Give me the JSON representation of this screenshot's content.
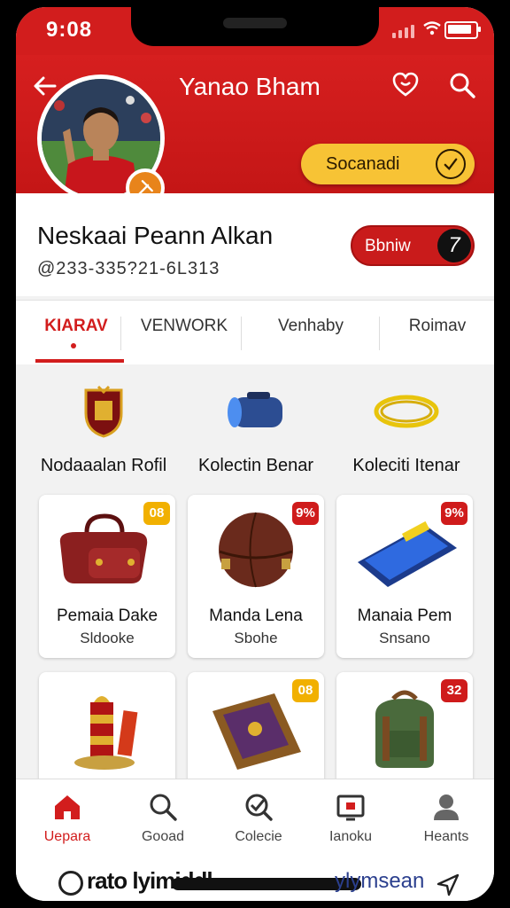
{
  "status": {
    "time": "9:08"
  },
  "header": {
    "title": "Yanao Bham",
    "action_pill": "Socanadi",
    "colors": {
      "primary": "#d21d1d",
      "accent": "#f7c335"
    }
  },
  "profile": {
    "name": "Neskaai Peann Alkan",
    "id": "@233-335?21-6L313",
    "follow_label": "Bbniw",
    "follow_icon_text": "7"
  },
  "tabs": [
    "KIARAV",
    "VENWORK",
    "Venhaby",
    "Roimav"
  ],
  "featured": [
    {
      "label": "Nodaaalan Rofil",
      "icon": "crest-icon"
    },
    {
      "label": "Kolectin Benar",
      "icon": "capsule-icon"
    },
    {
      "label": "Koleciti Itenar",
      "icon": "rope-icon"
    }
  ],
  "cards": [
    {
      "title": "Pemaia Dake",
      "subtitle": "Sldooke",
      "badge": "08",
      "badge_color": "#f1b000",
      "icon": "bag-icon"
    },
    {
      "title": "Manda Lena",
      "subtitle": "Sbohe",
      "badge": "9%",
      "badge_color": "#cf1b1b",
      "icon": "ball-icon"
    },
    {
      "title": "Manaia Pem",
      "subtitle": "Snsano",
      "badge": "9%",
      "badge_color": "#cf1b1b",
      "icon": "phone-icon"
    },
    {
      "title": "",
      "subtitle": "",
      "badge": "",
      "badge_color": "#f1b000",
      "icon": "trophy-icon"
    },
    {
      "title": "",
      "subtitle": "",
      "badge": "08",
      "badge_color": "#f1b000",
      "icon": "wallet-icon"
    },
    {
      "title": "",
      "subtitle": "",
      "badge": "32",
      "badge_color": "#cf1b1b",
      "icon": "backpack-icon"
    }
  ],
  "bottom_nav": [
    {
      "label": "Uepara",
      "icon": "home-icon"
    },
    {
      "label": "Gooad",
      "icon": "search-icon"
    },
    {
      "label": "Colecie",
      "icon": "check-icon"
    },
    {
      "label": "Ianoku",
      "icon": "tv-icon"
    },
    {
      "label": "Heants",
      "icon": "user-icon"
    }
  ],
  "browser": {
    "url_left": "rato lyimiddl",
    "url_right": "ylymsean"
  }
}
